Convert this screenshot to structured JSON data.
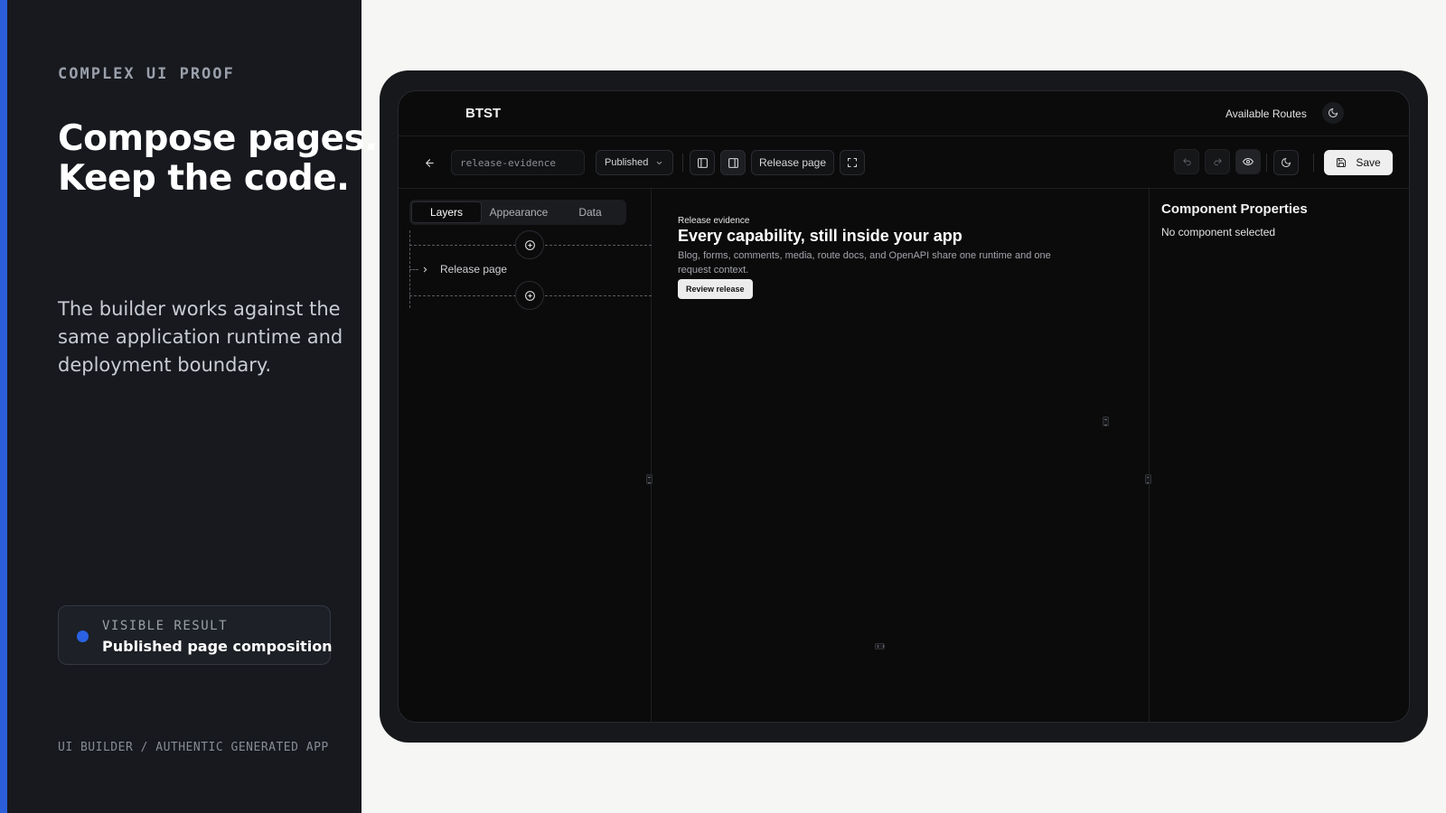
{
  "promo": {
    "eyebrow": "COMPLEX UI PROOF",
    "headline_line1": "Compose pages.",
    "headline_line2": "Keep the code.",
    "lede": "The builder works against the same application runtime and deployment boundary.",
    "result_kicker": "VISIBLE RESULT",
    "result_title": "Published page composition",
    "footer": "UI BUILDER / AUTHENTIC GENERATED APP",
    "accent_color": "#2b5fd9"
  },
  "app": {
    "brand": "BTST",
    "nav_link": "Available Routes",
    "nav_icons": [
      "moon-icon"
    ]
  },
  "toolbar": {
    "slug_value": "release-evidence",
    "status": "Published",
    "page_label": "Release page",
    "save_label": "Save",
    "icons": [
      "arrow-left-icon",
      "panel-left-icon",
      "panel-right-icon",
      "fullscreen-icon",
      "undo-icon",
      "redo-icon",
      "eye-icon",
      "moon-icon",
      "save-icon"
    ]
  },
  "sidebar": {
    "tabs": [
      {
        "label": "Layers",
        "active": true
      },
      {
        "label": "Appearance",
        "active": false
      },
      {
        "label": "Data",
        "active": false
      }
    ],
    "tree": [
      {
        "label": "Release page"
      }
    ]
  },
  "canvas": {
    "kicker": "Release evidence",
    "title": "Every capability, still inside your app",
    "body": "Blog, forms, comments, media, route docs, and OpenAPI share one runtime and one request context.",
    "cta": "Review release"
  },
  "properties": {
    "title": "Component Properties",
    "empty_state": "No component selected"
  }
}
